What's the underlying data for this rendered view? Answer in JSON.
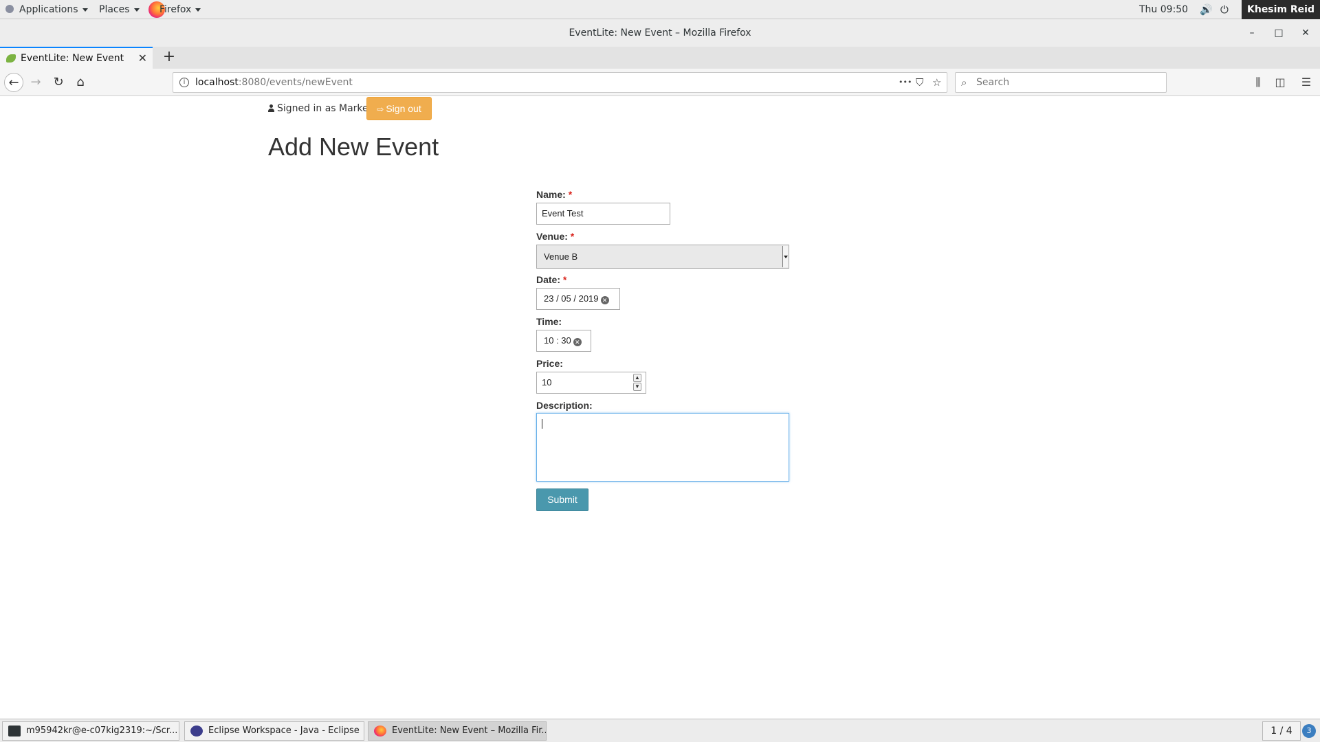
{
  "topbar": {
    "applications": "Applications",
    "places": "Places",
    "firefox": "Firefox",
    "clock": "Thu 09:50",
    "user": "Khesim Reid"
  },
  "window": {
    "title": "EventLite: New Event – Mozilla Firefox",
    "minimize": "–",
    "maximize": "□",
    "close": "✕"
  },
  "tabs": [
    {
      "label": "EventLite: New Event",
      "close": "✕",
      "active": true
    }
  ],
  "newtab_label": "+",
  "url": {
    "host": "localhost",
    "path": ":8080/events/newEvent",
    "more": "•••"
  },
  "search": {
    "placeholder": "Search"
  },
  "page": {
    "signed_in": "Signed in as Markel",
    "signout": "Sign out",
    "heading": "Add New Event",
    "form": {
      "name_label": "Name:",
      "name_value": "Event Test",
      "venue_label": "Venue:",
      "venue_value": "Venue B",
      "date_label": "Date:",
      "date_value": "23 / 05 / 2019",
      "time_label": "Time:",
      "time_value": "10 : 30",
      "price_label": "Price:",
      "price_value": "10",
      "description_label": "Description:",
      "description_value": "",
      "required_mark": "*",
      "submit": "Submit"
    }
  },
  "taskbar": {
    "items": [
      {
        "label": "m95942kr@e-c07kig2319:~/Scr...",
        "icon": "terminal-icon"
      },
      {
        "label": "Eclipse Workspace - Java - Eclipse",
        "icon": "eclipse-icon"
      },
      {
        "label": "EventLite: New Event – Mozilla Fir...",
        "icon": "firefox-icon"
      }
    ],
    "pager": "1 / 4",
    "notifications": "3"
  },
  "colors": {
    "signout_bg": "#f0ad4e",
    "submit_bg": "#4a98ad",
    "required": "#d9241c",
    "tab_accent": "#0a84ff"
  }
}
